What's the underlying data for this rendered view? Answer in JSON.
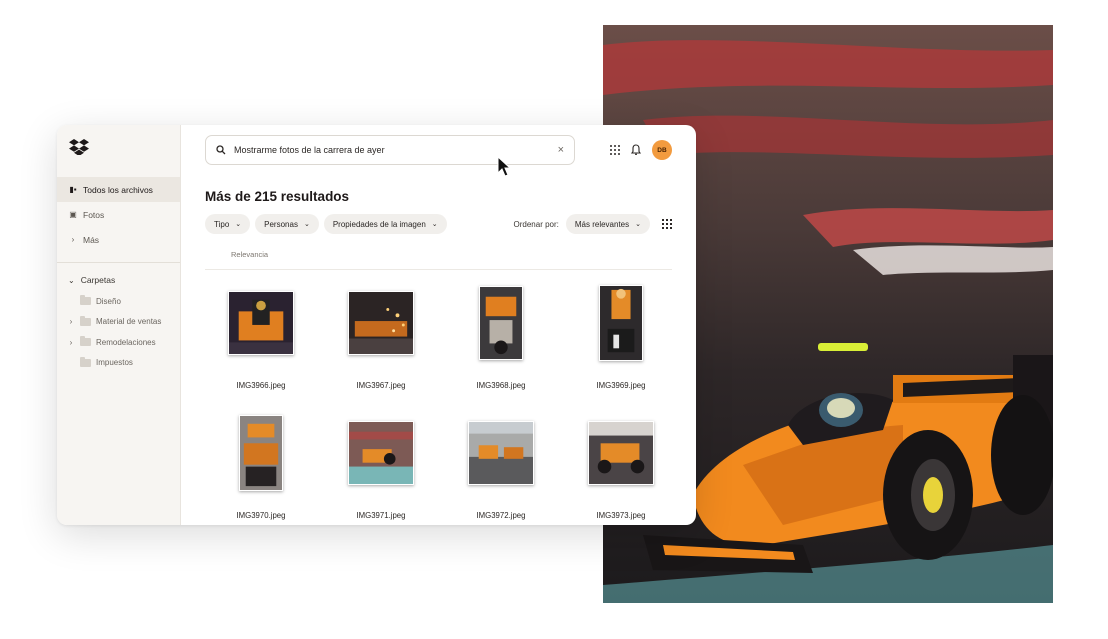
{
  "search": {
    "query": "Mostrarme fotos de la carrera de ayer"
  },
  "header": {
    "avatar_initials": "DB"
  },
  "sidebar": {
    "items": [
      {
        "label": "Todos los archivos",
        "icon": "files-icon",
        "active": true
      },
      {
        "label": "Fotos",
        "icon": "photos-icon",
        "active": false
      },
      {
        "label": "Más",
        "icon": "chevron-right-icon",
        "active": false
      }
    ],
    "folders_label": "Carpetas",
    "folders": [
      {
        "label": "Diseño",
        "expandable": false
      },
      {
        "label": "Material de ventas",
        "expandable": true
      },
      {
        "label": "Remodelaciones",
        "expandable": true
      },
      {
        "label": "Impuestos",
        "expandable": false
      }
    ]
  },
  "results": {
    "title": "Más de 215 resultados",
    "filters": [
      "Tipo",
      "Personas",
      "Propiedades de la imagen"
    ],
    "sort_label": "Ordenar por:",
    "sort_value": "Más relevantes",
    "column_header": "Relevancia"
  },
  "files": [
    {
      "name": "IMG3966.jpeg"
    },
    {
      "name": "IMG3967.jpeg"
    },
    {
      "name": "IMG3968.jpeg"
    },
    {
      "name": "IMG3969.jpeg"
    },
    {
      "name": "IMG3970.jpeg"
    },
    {
      "name": "IMG3971.jpeg"
    },
    {
      "name": "IMG3972.jpeg"
    },
    {
      "name": "IMG3973.jpeg"
    }
  ],
  "colors": {
    "accent": "#f29b3f",
    "sidebar_bg": "#f7f5f2",
    "car_orange": "#f28a1e"
  }
}
